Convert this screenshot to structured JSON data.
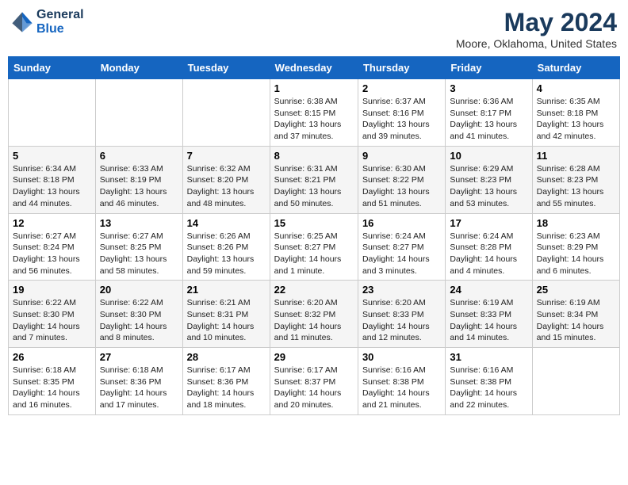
{
  "header": {
    "logo_line1": "General",
    "logo_line2": "Blue",
    "month_title": "May 2024",
    "location": "Moore, Oklahoma, United States"
  },
  "weekdays": [
    "Sunday",
    "Monday",
    "Tuesday",
    "Wednesday",
    "Thursday",
    "Friday",
    "Saturday"
  ],
  "weeks": [
    [
      {
        "day": "",
        "info": ""
      },
      {
        "day": "",
        "info": ""
      },
      {
        "day": "",
        "info": ""
      },
      {
        "day": "1",
        "info": "Sunrise: 6:38 AM\nSunset: 8:15 PM\nDaylight: 13 hours and 37 minutes."
      },
      {
        "day": "2",
        "info": "Sunrise: 6:37 AM\nSunset: 8:16 PM\nDaylight: 13 hours and 39 minutes."
      },
      {
        "day": "3",
        "info": "Sunrise: 6:36 AM\nSunset: 8:17 PM\nDaylight: 13 hours and 41 minutes."
      },
      {
        "day": "4",
        "info": "Sunrise: 6:35 AM\nSunset: 8:18 PM\nDaylight: 13 hours and 42 minutes."
      }
    ],
    [
      {
        "day": "5",
        "info": "Sunrise: 6:34 AM\nSunset: 8:18 PM\nDaylight: 13 hours and 44 minutes."
      },
      {
        "day": "6",
        "info": "Sunrise: 6:33 AM\nSunset: 8:19 PM\nDaylight: 13 hours and 46 minutes."
      },
      {
        "day": "7",
        "info": "Sunrise: 6:32 AM\nSunset: 8:20 PM\nDaylight: 13 hours and 48 minutes."
      },
      {
        "day": "8",
        "info": "Sunrise: 6:31 AM\nSunset: 8:21 PM\nDaylight: 13 hours and 50 minutes."
      },
      {
        "day": "9",
        "info": "Sunrise: 6:30 AM\nSunset: 8:22 PM\nDaylight: 13 hours and 51 minutes."
      },
      {
        "day": "10",
        "info": "Sunrise: 6:29 AM\nSunset: 8:23 PM\nDaylight: 13 hours and 53 minutes."
      },
      {
        "day": "11",
        "info": "Sunrise: 6:28 AM\nSunset: 8:23 PM\nDaylight: 13 hours and 55 minutes."
      }
    ],
    [
      {
        "day": "12",
        "info": "Sunrise: 6:27 AM\nSunset: 8:24 PM\nDaylight: 13 hours and 56 minutes."
      },
      {
        "day": "13",
        "info": "Sunrise: 6:27 AM\nSunset: 8:25 PM\nDaylight: 13 hours and 58 minutes."
      },
      {
        "day": "14",
        "info": "Sunrise: 6:26 AM\nSunset: 8:26 PM\nDaylight: 13 hours and 59 minutes."
      },
      {
        "day": "15",
        "info": "Sunrise: 6:25 AM\nSunset: 8:27 PM\nDaylight: 14 hours and 1 minute."
      },
      {
        "day": "16",
        "info": "Sunrise: 6:24 AM\nSunset: 8:27 PM\nDaylight: 14 hours and 3 minutes."
      },
      {
        "day": "17",
        "info": "Sunrise: 6:24 AM\nSunset: 8:28 PM\nDaylight: 14 hours and 4 minutes."
      },
      {
        "day": "18",
        "info": "Sunrise: 6:23 AM\nSunset: 8:29 PM\nDaylight: 14 hours and 6 minutes."
      }
    ],
    [
      {
        "day": "19",
        "info": "Sunrise: 6:22 AM\nSunset: 8:30 PM\nDaylight: 14 hours and 7 minutes."
      },
      {
        "day": "20",
        "info": "Sunrise: 6:22 AM\nSunset: 8:30 PM\nDaylight: 14 hours and 8 minutes."
      },
      {
        "day": "21",
        "info": "Sunrise: 6:21 AM\nSunset: 8:31 PM\nDaylight: 14 hours and 10 minutes."
      },
      {
        "day": "22",
        "info": "Sunrise: 6:20 AM\nSunset: 8:32 PM\nDaylight: 14 hours and 11 minutes."
      },
      {
        "day": "23",
        "info": "Sunrise: 6:20 AM\nSunset: 8:33 PM\nDaylight: 14 hours and 12 minutes."
      },
      {
        "day": "24",
        "info": "Sunrise: 6:19 AM\nSunset: 8:33 PM\nDaylight: 14 hours and 14 minutes."
      },
      {
        "day": "25",
        "info": "Sunrise: 6:19 AM\nSunset: 8:34 PM\nDaylight: 14 hours and 15 minutes."
      }
    ],
    [
      {
        "day": "26",
        "info": "Sunrise: 6:18 AM\nSunset: 8:35 PM\nDaylight: 14 hours and 16 minutes."
      },
      {
        "day": "27",
        "info": "Sunrise: 6:18 AM\nSunset: 8:36 PM\nDaylight: 14 hours and 17 minutes."
      },
      {
        "day": "28",
        "info": "Sunrise: 6:17 AM\nSunset: 8:36 PM\nDaylight: 14 hours and 18 minutes."
      },
      {
        "day": "29",
        "info": "Sunrise: 6:17 AM\nSunset: 8:37 PM\nDaylight: 14 hours and 20 minutes."
      },
      {
        "day": "30",
        "info": "Sunrise: 6:16 AM\nSunset: 8:38 PM\nDaylight: 14 hours and 21 minutes."
      },
      {
        "day": "31",
        "info": "Sunrise: 6:16 AM\nSunset: 8:38 PM\nDaylight: 14 hours and 22 minutes."
      },
      {
        "day": "",
        "info": ""
      }
    ]
  ]
}
